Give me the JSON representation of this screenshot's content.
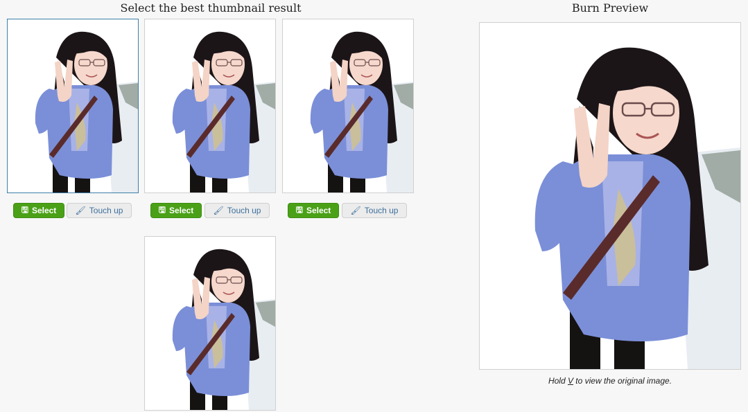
{
  "left_panel": {
    "title": "Select the best thumbnail result",
    "thumbnails": [
      {
        "alt": "Thumbnail result 1",
        "selected": true
      },
      {
        "alt": "Thumbnail result 2",
        "selected": false
      },
      {
        "alt": "Thumbnail result 3",
        "selected": false
      },
      {
        "alt": "Thumbnail result 4",
        "selected": false
      }
    ],
    "select_label": "Select",
    "touchup_label": "Touch up",
    "icons": {
      "select": "save-icon",
      "touchup": "brush-icon"
    }
  },
  "right_panel": {
    "title": "Burn Preview",
    "hint_prefix": "Hold ",
    "hint_key": "V",
    "hint_suffix": " to view the original image."
  },
  "colors": {
    "select_button": "#4aa117",
    "touchup_text": "#3d6f9c",
    "selected_border": "#3c7fa8",
    "jacket": "#7b8fd8",
    "hair": "#1c1518"
  }
}
